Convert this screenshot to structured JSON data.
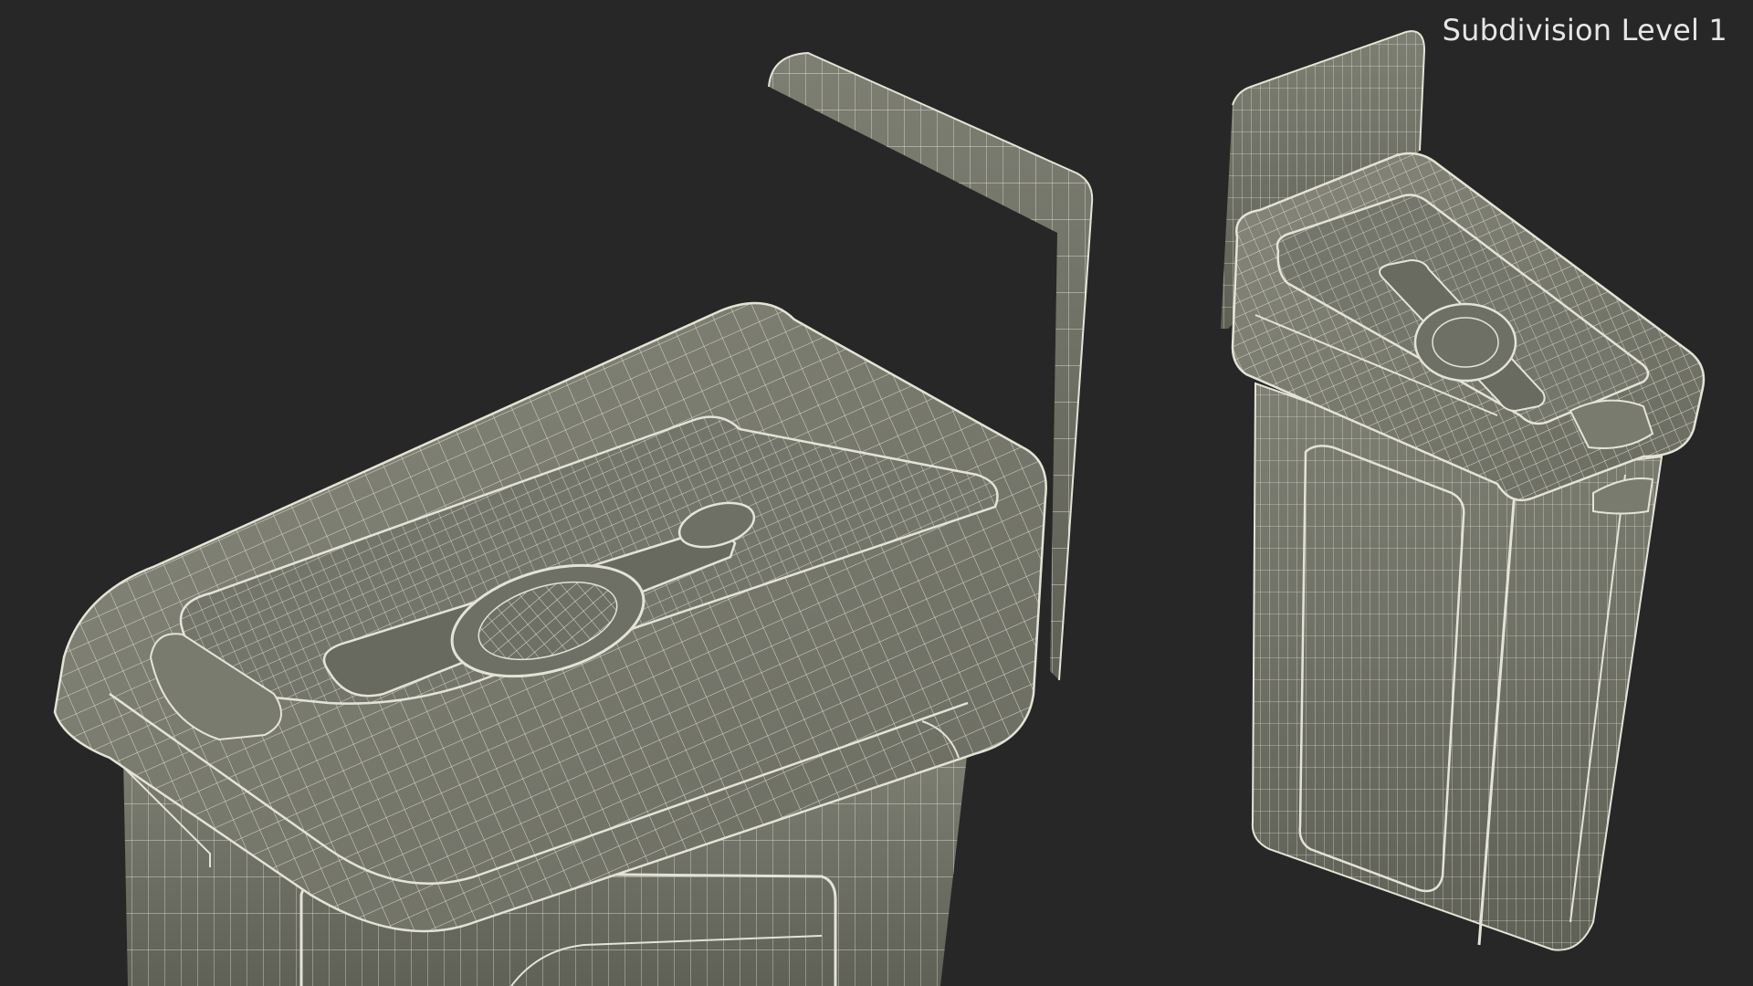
{
  "viewport": {
    "overlay_label": "Subdivision Level 1",
    "background_color": "#272727",
    "surface_color": "#7a7b6f",
    "wire_color": "#e4e3d6"
  }
}
